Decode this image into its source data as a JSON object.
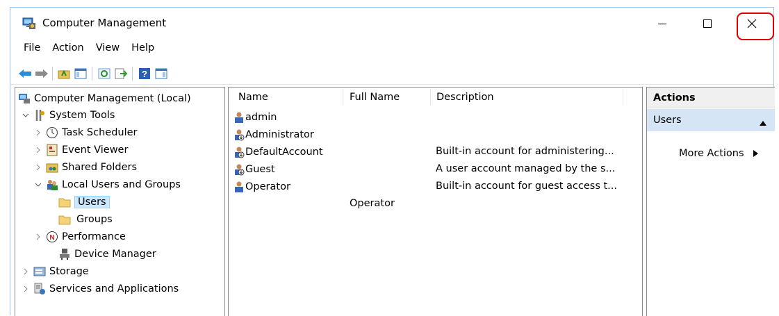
{
  "window": {
    "title": "Computer Management"
  },
  "menu": [
    "File",
    "Action",
    "View",
    "Help"
  ],
  "toolbar_icons": [
    "back-arrow-icon",
    "forward-arrow-icon",
    "up-folder-icon",
    "show-hide-tree-icon",
    "refresh-icon",
    "export-list-icon",
    "help-icon",
    "show-hide-action-pane-icon"
  ],
  "tree": {
    "root": "Computer Management (Local)",
    "system_tools": "System Tools",
    "task_scheduler": "Task Scheduler",
    "event_viewer": "Event Viewer",
    "shared_folders": "Shared Folders",
    "local_users_groups": "Local Users and Groups",
    "users": "Users",
    "groups": "Groups",
    "performance": "Performance",
    "device_manager": "Device Manager",
    "storage": "Storage",
    "services_apps": "Services and Applications",
    "selected": "Users"
  },
  "list": {
    "columns": [
      "Name",
      "Full Name",
      "Description"
    ],
    "rows": [
      {
        "name": "admin",
        "full_name": "",
        "description": ""
      },
      {
        "name": "Administrator",
        "full_name": "",
        "description": "Built-in account for administering..."
      },
      {
        "name": "DefaultAccount",
        "full_name": "",
        "description": "A user account managed by the s..."
      },
      {
        "name": "Guest",
        "full_name": "",
        "description": "Built-in account for guest access t..."
      },
      {
        "name": "Operator",
        "full_name": "Operator",
        "description": ""
      }
    ]
  },
  "actions": {
    "header": "Actions",
    "section": "Users",
    "more": "More Actions"
  },
  "colors": {
    "selection": "#cce8ff",
    "actions_section": "#d6e5f5",
    "close_highlight": "#e00000"
  }
}
